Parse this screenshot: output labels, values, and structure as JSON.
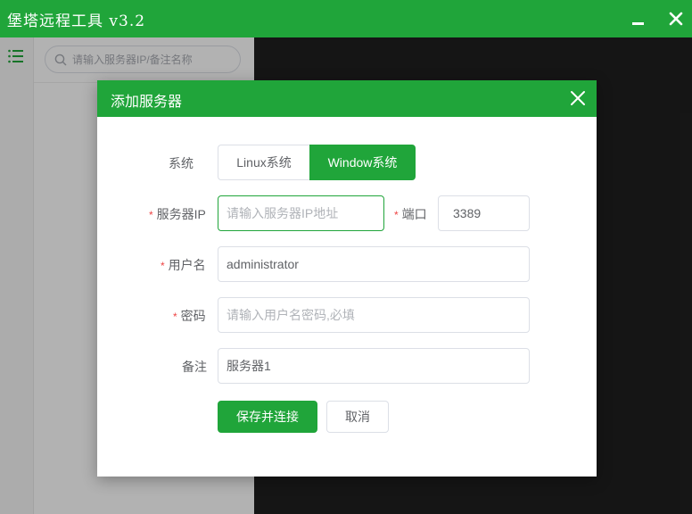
{
  "app": {
    "title": "堡塔远程工具 v3.2",
    "minimize_icon": "minimize-icon",
    "close_icon": "close-icon"
  },
  "sidebar": {
    "menu_icon": "list-menu-icon"
  },
  "search": {
    "placeholder": "请输入服务器IP/备注名称",
    "value": ""
  },
  "dialog": {
    "title": "添加服务器",
    "close_icon": "close-icon",
    "system": {
      "label": "系统",
      "options": [
        "Linux系统",
        "Window系统"
      ],
      "selected": "Window系统"
    },
    "server_ip": {
      "label": "服务器IP",
      "placeholder": "请输入服务器IP地址",
      "value": ""
    },
    "port": {
      "label": "端口",
      "value": "3389"
    },
    "username": {
      "label": "用户名",
      "value": "administrator"
    },
    "password": {
      "label": "密码",
      "placeholder": "请输入用户名密码,必填",
      "value": ""
    },
    "remark": {
      "label": "备注",
      "value": "服务器1"
    },
    "save_label": "保存并连接",
    "cancel_label": "取消",
    "required_mark": "*"
  },
  "colors": {
    "brand": "#20a53a",
    "terminal_bg": "#1f1f1f",
    "required": "#e44444"
  }
}
